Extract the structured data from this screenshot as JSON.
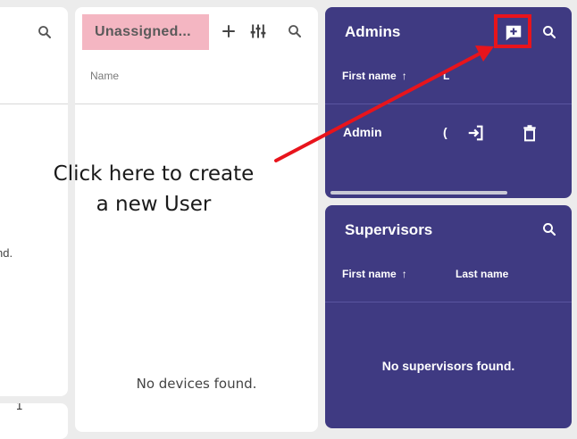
{
  "left_panel": {
    "empty_text_fragment": "nd.",
    "page_number_fragment": "1"
  },
  "devices_panel": {
    "filter_chip": "Unassigned...",
    "column_name": "Name",
    "empty_text": "No devices found."
  },
  "admins_panel": {
    "title": "Admins",
    "col_first_name": "First name",
    "col_last_name_fragment": "L",
    "rows": [
      {
        "first_name": "Admin",
        "last_name_fragment": "("
      }
    ]
  },
  "supervisors_panel": {
    "title": "Supervisors",
    "col_first_name": "First name",
    "col_last_name": "Last name",
    "empty_text": "No supervisors found."
  },
  "annotation": {
    "line1": "Click here to create",
    "line2": "a new User",
    "color": "#e8141c"
  },
  "colors": {
    "panel_dark": "#3f3a82",
    "chip_bg": "#f4b6c2",
    "background": "#ececec"
  }
}
